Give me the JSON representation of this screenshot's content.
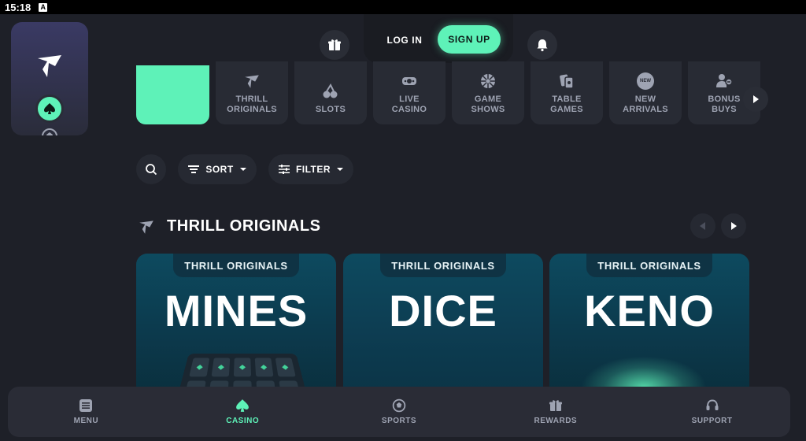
{
  "status": {
    "time": "15:18",
    "indicator": "A"
  },
  "header": {
    "login_label": "LOG IN",
    "signup_label": "SIGN UP"
  },
  "categories": [
    {
      "label": "THRILL\nORIGINALS",
      "icon": "thrill-logo-icon"
    },
    {
      "label": "SLOTS",
      "icon": "cherries-icon"
    },
    {
      "label": "LIVE\nCASINO",
      "icon": "live-casino-icon"
    },
    {
      "label": "GAME\nSHOWS",
      "icon": "wheel-icon"
    },
    {
      "label": "TABLE\nGAMES",
      "icon": "cards-icon"
    },
    {
      "label": "NEW\nARRIVALS",
      "icon": "new-badge-icon",
      "badge": "NEW"
    },
    {
      "label": "BONUS\nBUYS",
      "icon": "bonus-buy-icon"
    }
  ],
  "toolbar": {
    "sort_label": "SORT",
    "filter_label": "FILTER"
  },
  "section": {
    "title": "THRILL ORIGINALS"
  },
  "games": [
    {
      "tag": "THRILL ORIGINALS",
      "name": "MINES"
    },
    {
      "tag": "THRILL ORIGINALS",
      "name": "DICE"
    },
    {
      "tag": "THRILL ORIGINALS",
      "name": "KENO"
    }
  ],
  "bottom_nav": [
    {
      "label": "MENU",
      "icon": "menu-icon",
      "active": false
    },
    {
      "label": "CASINO",
      "icon": "spade-icon",
      "active": true
    },
    {
      "label": "SPORTS",
      "icon": "soccer-ball-icon",
      "active": false
    },
    {
      "label": "REWARDS",
      "icon": "gift-icon",
      "active": false
    },
    {
      "label": "SUPPORT",
      "icon": "headset-icon",
      "active": false
    }
  ],
  "colors": {
    "accent": "#5ef2b8",
    "background": "#1e2028",
    "muted_text": "#9ea3b2"
  }
}
